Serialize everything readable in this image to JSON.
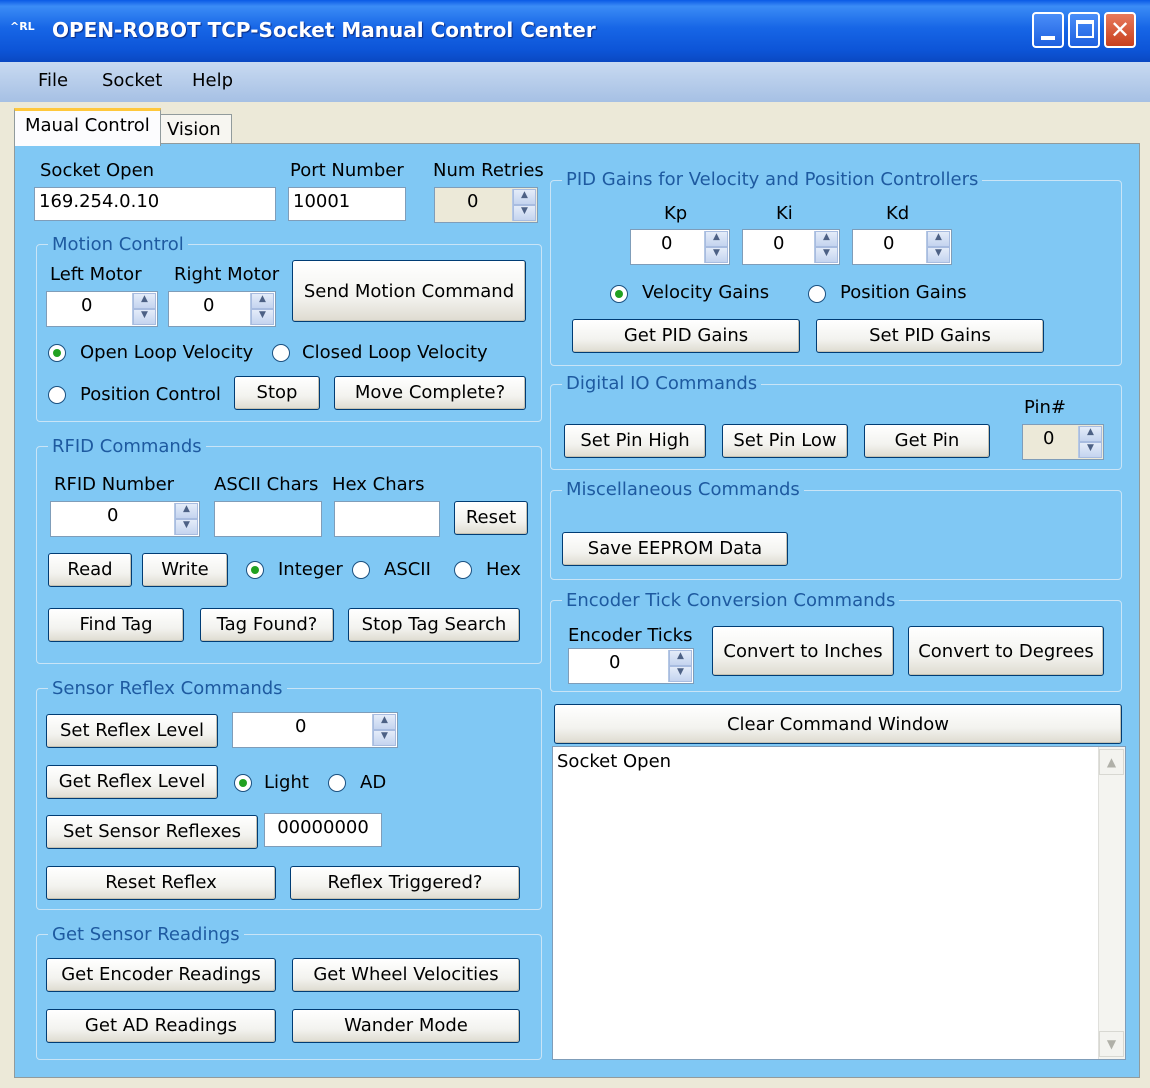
{
  "window": {
    "title": "OPEN-ROBOT TCP-Socket Manual Control Center",
    "icon_text": "^RL"
  },
  "menu": [
    "File",
    "Socket",
    "Help"
  ],
  "tabs": [
    "Maual Control",
    "Vision"
  ],
  "socket": {
    "label": "Socket Open",
    "value": "169.254.0.10",
    "port_label": "Port Number",
    "port_value": "10001",
    "retries_label": "Num Retries",
    "retries_value": "0"
  },
  "motion": {
    "title": "Motion Control",
    "left_label": "Left Motor",
    "left_value": "0",
    "right_label": "Right Motor",
    "right_value": "0",
    "send_button": "Send Motion Command",
    "open_loop": "Open Loop Velocity",
    "closed_loop": "Closed Loop Velocity",
    "position": "Position Control",
    "stop_button": "Stop",
    "move_complete_button": "Move Complete?",
    "selected": "Open Loop Velocity"
  },
  "rfid": {
    "title": "RFID Commands",
    "number_label": "RFID Number",
    "number_value": "0",
    "ascii_label": "ASCII Chars",
    "ascii_value": "",
    "hex_label": "Hex Chars",
    "hex_value": "",
    "reset_button": "Reset",
    "read_button": "Read",
    "write_button": "Write",
    "integer": "Integer",
    "ascii": "ASCII",
    "hex": "Hex",
    "selected": "Integer",
    "find_tag_button": "Find Tag",
    "tag_found_button": "Tag Found?",
    "stop_search_button": "Stop Tag Search"
  },
  "reflex": {
    "title": "Sensor Reflex Commands",
    "set_level_button": "Set Reflex Level",
    "level_value": "0",
    "get_level_button": "Get Reflex Level",
    "light": "Light",
    "ad": "AD",
    "selected": "Light",
    "set_reflexes_button": "Set Sensor Reflexes",
    "reflexes_value": "00000000",
    "reset_button": "Reset Reflex",
    "triggered_button": "Reflex Triggered?"
  },
  "readings": {
    "title": "Get Sensor Readings",
    "encoder_button": "Get Encoder Readings",
    "wheel_button": "Get Wheel Velocities",
    "ad_button": "Get AD Readings",
    "wander_button": "Wander Mode"
  },
  "pid": {
    "title": "PID Gains for Velocity and Position Controllers",
    "kp_label": "Kp",
    "kp_value": "0",
    "ki_label": "Ki",
    "ki_value": "0",
    "kd_label": "Kd",
    "kd_value": "0",
    "velocity": "Velocity Gains",
    "position": "Position Gains",
    "selected": "Velocity Gains",
    "get_button": "Get PID Gains",
    "set_button": "Set PID Gains"
  },
  "digital_io": {
    "title": "Digital IO Commands",
    "pin_label": "Pin#",
    "pin_value": "0",
    "set_high_button": "Set Pin High",
    "set_low_button": "Set Pin Low",
    "get_pin_button": "Get Pin"
  },
  "misc": {
    "title": "Miscellaneous Commands",
    "save_button": "Save EEPROM Data"
  },
  "encoder": {
    "title": "Encoder Tick Conversion Commands",
    "ticks_label": "Encoder Ticks",
    "ticks_value": "0",
    "inches_button": "Convert to Inches",
    "degrees_button": "Convert to Degrees"
  },
  "command_window": {
    "clear_button": "Clear Command Window",
    "text": "Socket Open"
  },
  "colors": {
    "panel": "#80c8f4",
    "titlebar": "#0a5ae6",
    "group_label": "#1e5aa0",
    "radio_dot": "#21a121"
  }
}
